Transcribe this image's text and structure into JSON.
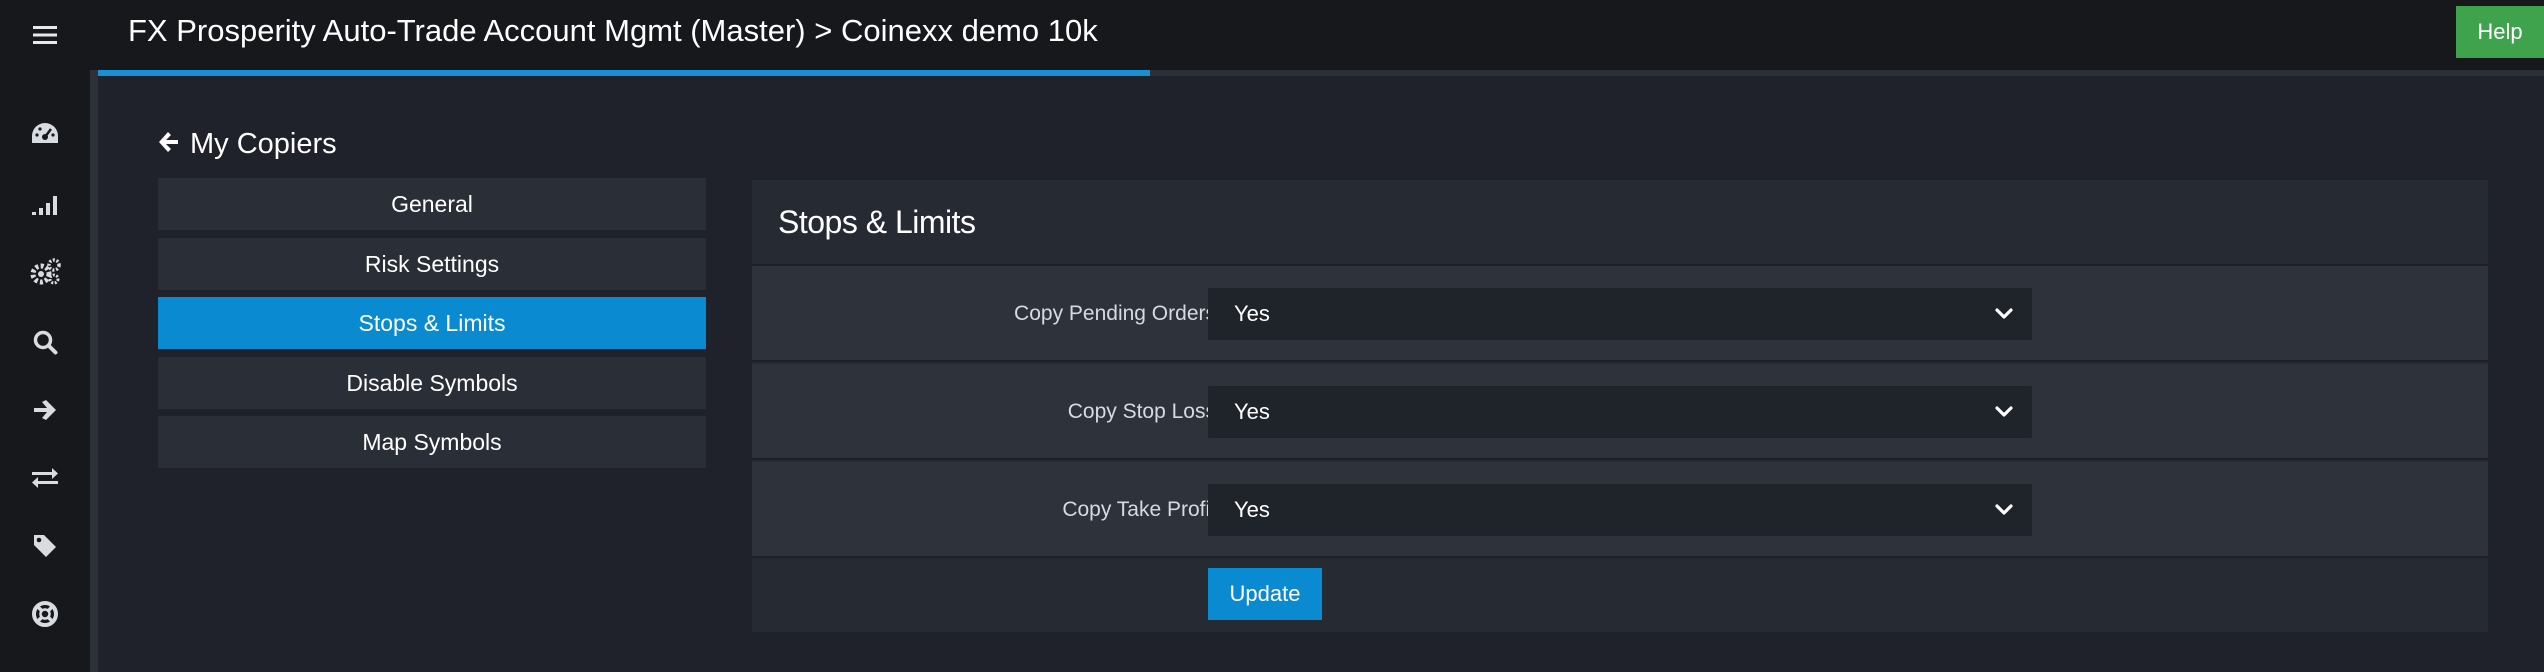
{
  "header": {
    "title": "FX Prosperity Auto-Trade Account Mgmt (Master) > Coinexx demo 10k",
    "help_label": "Help",
    "menu_icon": "hamburger-icon",
    "progress": 0.43
  },
  "sidebar": {
    "icons": [
      "dashboard-icon",
      "signal-icon",
      "settings-icon",
      "search-icon",
      "arrow-right-icon",
      "exchange-icon",
      "tag-icon",
      "support-icon"
    ]
  },
  "back_link": {
    "label": "My Copiers",
    "icon": "arrow-left-icon"
  },
  "nav": {
    "items": [
      {
        "label": "General"
      },
      {
        "label": "Risk Settings"
      },
      {
        "label": "Stops & Limits"
      },
      {
        "label": "Disable Symbols"
      },
      {
        "label": "Map Symbols"
      }
    ],
    "active_index": 2
  },
  "panel": {
    "title": "Stops & Limits",
    "fields": [
      {
        "label": "Copy Pending Orders",
        "value": "Yes"
      },
      {
        "label": "Copy Stop Loss",
        "value": "Yes"
      },
      {
        "label": "Copy Take Profit",
        "value": "Yes"
      }
    ],
    "update_label": "Update"
  },
  "colors": {
    "accent": "#0a8ad0",
    "help": "#3fa34d",
    "background": "#1f222a",
    "panel": "#262a32"
  }
}
